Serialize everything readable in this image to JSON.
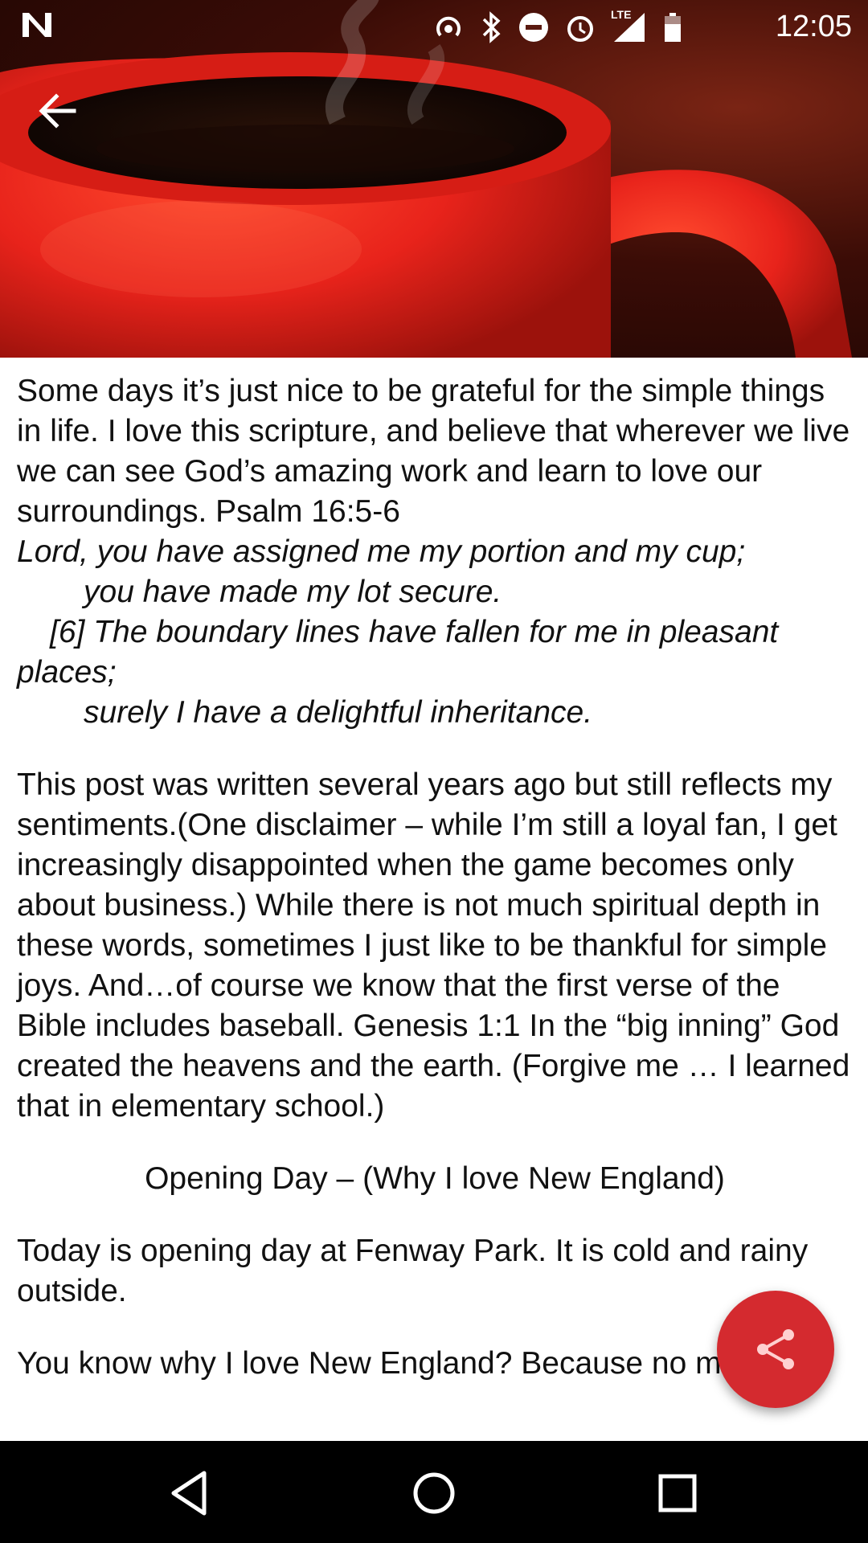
{
  "status_bar": {
    "time": "12:05",
    "network_label": "LTE"
  },
  "toolbar": {
    "back_icon": "arrow-left-icon"
  },
  "article": {
    "intro": "Some days it’s just nice to be grateful for the simple things in life.  I love this scripture, and believe that wherever we live we can see God’s amazing work and learn to love our surroundings. Psalm 16:5-6",
    "verse_line1": "Lord, you have assigned me my portion and my cup;",
    "verse_line2": "you have made my lot secure.",
    "verse_line3": "[6] The boundary lines have fallen for me in pleasant places;",
    "verse_line4": "surely I have a delightful inheritance.",
    "para2": "This post was written several years ago but still reflects my sentiments.(One disclaimer – while I’m still a loyal fan, I get increasingly disappointed when the game becomes only about business.)  While there is not much spiritual depth in these words, sometimes I just like to be thankful for simple joys. And…of course we know that the first verse of the Bible includes baseball. Genesis 1:1  In the “big inning” God created the heavens and the earth.  (Forgive me … I  learned that in elementary school.)",
    "subheading": "Opening Day – (Why I love New England)",
    "para3": "Today is opening day at Fenway Park. It is cold and rainy outside.",
    "para4": "You know why I love New England? Because no matter"
  },
  "fab": {
    "icon": "share-icon"
  },
  "nav_bar": {
    "back_icon": "nav-back-icon",
    "home_icon": "nav-home-icon",
    "recents_icon": "nav-recents-icon"
  },
  "colors": {
    "accent": "#d42a2f",
    "mug": "#e8231b"
  }
}
